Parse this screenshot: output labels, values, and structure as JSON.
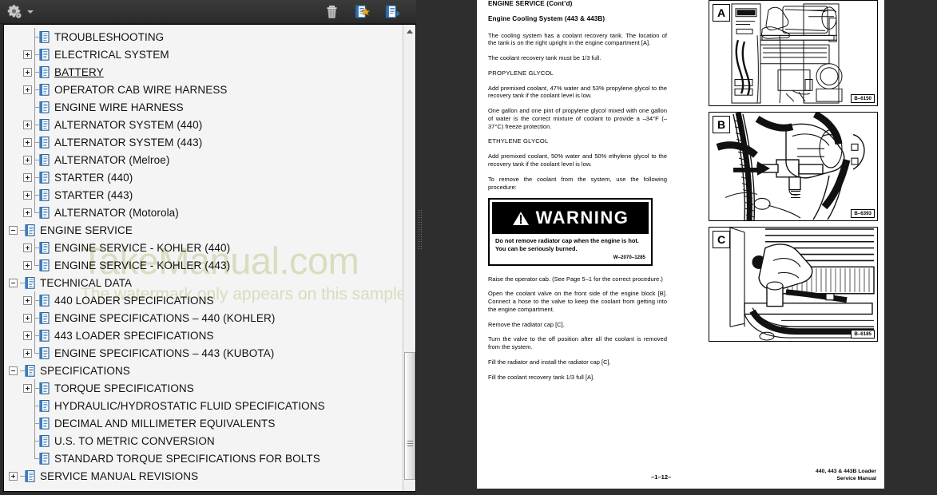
{
  "toolbar": {
    "options_icon": "gear-icon",
    "options_caret": "chevron-down-icon",
    "delete_icon": "trash-icon",
    "new_bookmark_icon": "new-bookmark-document-icon",
    "goto_icon": "goto-document-icon"
  },
  "watermark": {
    "main": "TakeManual.com",
    "sub": "The watermark only appears on this sample"
  },
  "tree": {
    "items": [
      {
        "label": "TROUBLESHOOTING",
        "depth": 1,
        "expander": "none",
        "underline": false
      },
      {
        "label": "ELECTRICAL SYSTEM",
        "depth": 1,
        "expander": "plus",
        "underline": false
      },
      {
        "label": "BATTERY",
        "depth": 1,
        "expander": "plus",
        "underline": true
      },
      {
        "label": "OPERATOR CAB WIRE HARNESS",
        "depth": 1,
        "expander": "plus",
        "underline": false
      },
      {
        "label": "ENGINE WIRE HARNESS",
        "depth": 1,
        "expander": "none",
        "underline": false
      },
      {
        "label": "ALTERNATOR SYSTEM (440)",
        "depth": 1,
        "expander": "plus",
        "underline": false
      },
      {
        "label": "ALTERNATOR SYSTEM (443)",
        "depth": 1,
        "expander": "plus",
        "underline": false
      },
      {
        "label": "ALTERNATOR (Melroe)",
        "depth": 1,
        "expander": "plus",
        "underline": false
      },
      {
        "label": "STARTER (440)",
        "depth": 1,
        "expander": "plus",
        "underline": false
      },
      {
        "label": "STARTER (443)",
        "depth": 1,
        "expander": "plus",
        "underline": false
      },
      {
        "label": "ALTERNATOR (Motorola)",
        "depth": 1,
        "expander": "plus",
        "underline": false
      },
      {
        "label": "ENGINE SERVICE",
        "depth": 0,
        "expander": "minus",
        "underline": false
      },
      {
        "label": "ENGINE SERVICE - KOHLER (440)",
        "depth": 1,
        "expander": "plus",
        "underline": false
      },
      {
        "label": "ENGINE SERVICE - KOHLER (443)",
        "depth": 1,
        "expander": "plus",
        "underline": false
      },
      {
        "label": "TECHNICAL DATA",
        "depth": 0,
        "expander": "minus",
        "underline": false
      },
      {
        "label": "440 LOADER SPECIFICATIONS",
        "depth": 1,
        "expander": "plus",
        "underline": false
      },
      {
        "label": "ENGINE SPECIFICATIONS – 440 (KOHLER)",
        "depth": 1,
        "expander": "plus",
        "underline": false
      },
      {
        "label": "443 LOADER SPECIFICATIONS",
        "depth": 1,
        "expander": "plus",
        "underline": false
      },
      {
        "label": "ENGINE SPECIFICATIONS – 443 (KUBOTA)",
        "depth": 1,
        "expander": "plus",
        "underline": false
      },
      {
        "label": "SPECIFICATIONS",
        "depth": 0,
        "expander": "minus",
        "underline": false
      },
      {
        "label": "TORQUE SPECIFICATIONS",
        "depth": 1,
        "expander": "plus",
        "underline": false
      },
      {
        "label": "HYDRAULIC/HYDROSTATIC FLUID SPECIFICATIONS",
        "depth": 1,
        "expander": "none",
        "underline": false
      },
      {
        "label": "DECIMAL AND MILLIMETER EQUIVALENTS",
        "depth": 1,
        "expander": "none",
        "underline": false
      },
      {
        "label": "U.S. TO METRIC CONVERSION",
        "depth": 1,
        "expander": "none",
        "underline": false
      },
      {
        "label": "STANDARD TORQUE SPECIFICATIONS FOR BOLTS",
        "depth": 1,
        "expander": "none",
        "underline": false
      },
      {
        "label": "SERVICE MANUAL REVISIONS",
        "depth": 0,
        "expander": "plus",
        "underline": false
      }
    ]
  },
  "scrollbar": {
    "up_icon": "scroll-up-arrow-icon",
    "down_icon": "scroll-down-arrow-icon"
  },
  "document": {
    "header": "ENGINE SERVICE (Cont’d)",
    "subheader": "Engine Cooling System (443 & 443B)",
    "p1": "The cooling system has a coolant recovery tank. The location of the tank is on the right upright in the engine compartment [A].",
    "p2": "The coolant recovery tank must be 1/3 full.",
    "h_propylene": "PROPYLENE GLYCOL",
    "p3": "Add premixed coolant, 47% water and 53% propylene glycol to the recovery tank if the coolant level is low.",
    "p4": "One gallon and one pint of propylene glycol mixed with one gallon of water is the correct mixture of coolant to provide a –34°F (–37°C) freeze protection.",
    "h_ethylene": "ETHYLENE GLYCOL",
    "p5": "Add premixed coolant, 50% water and 50% ethylene glycol to the recovery tank if the coolant level is low.",
    "p6": "To remove the coolant from the system, use the following procedure:",
    "warning": {
      "title": "WARNING",
      "icon": "warning-triangle-icon",
      "message": "Do not remove radiator cap when the engine is hot. You can be seriously burned.",
      "code": "W–2070–1285"
    },
    "p7": "Raise the operator cab. (See Page 5–1 for the correct procedure.)",
    "p8": "Open the coolant valve on the front side of the engine block [B]. Connect a hose to the valve to keep the coolant from getting into the engine compartment.",
    "p9": "Remove the radiator cap [C].",
    "p10": "Turn the valve to the off position after all the coolant is removed from the system.",
    "p11": "Fill the radiator and install the radiator cap [C].",
    "p12": "Fill the coolant recovery tank 1/3 full [A].",
    "figures": [
      {
        "label": "A",
        "code": "B–6150"
      },
      {
        "label": "B",
        "code": "B–6393"
      },
      {
        "label": "C",
        "code": "B–6185"
      }
    ],
    "page_number": "–1–12–",
    "footer_line1": "440, 443 & 443B Loader",
    "footer_line2": "Service Manual"
  },
  "colors": {
    "watermark": "#d7ddbe",
    "chrome": "#2e2e2e",
    "tree_bg": "#f4f4f4",
    "doc_icon_blue": "#2f6fae"
  }
}
